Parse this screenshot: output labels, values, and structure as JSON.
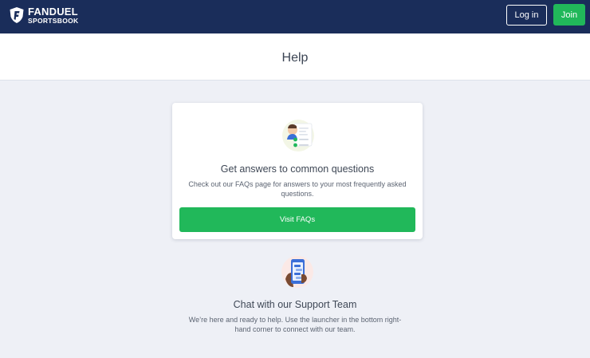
{
  "header": {
    "logo_line1": "FANDUEL",
    "logo_line2": "SPORTSBOOK",
    "login_label": "Log in",
    "join_label": "Join"
  },
  "page": {
    "title": "Help"
  },
  "faq_card": {
    "illustration": "faq-illustration-icon",
    "heading": "Get answers to common questions",
    "text": "Check out our FAQs page for answers to your most frequently asked questions.",
    "button_label": "Visit FAQs"
  },
  "chat_section": {
    "illustration": "chat-illustration-icon",
    "heading": "Chat with our Support Team",
    "text": "We’re here and ready to help. Use the launcher in the bottom right-hand corner to connect with our team."
  },
  "colors": {
    "navbar": "#1a2d5a",
    "accent_green": "#21b85a",
    "page_background": "#eef0f6"
  }
}
